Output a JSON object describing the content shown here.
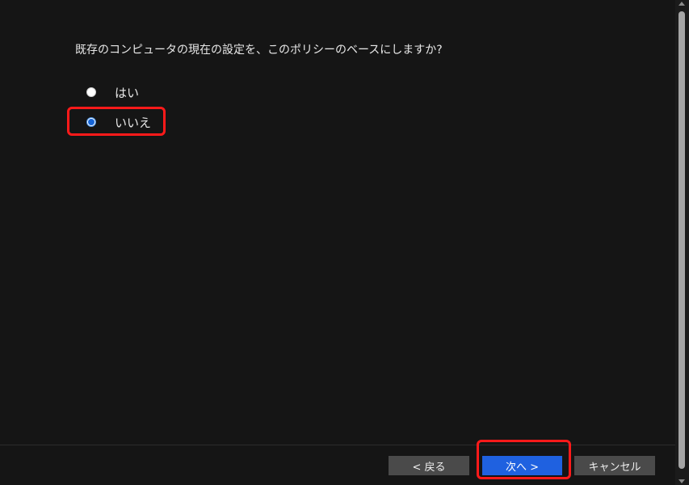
{
  "question": "既存のコンピュータの現在の設定を、このポリシーのベースにしますか?",
  "options": [
    {
      "label": "はい",
      "selected": false
    },
    {
      "label": "いいえ",
      "selected": true
    }
  ],
  "buttons": {
    "back": "< 戻る",
    "next": "次へ >",
    "cancel": "キャンセル"
  },
  "colors": {
    "background": "#151515",
    "primary_button": "#1f61e0",
    "secondary_button": "#4a4a4a",
    "highlight": "#ff1a1a"
  }
}
